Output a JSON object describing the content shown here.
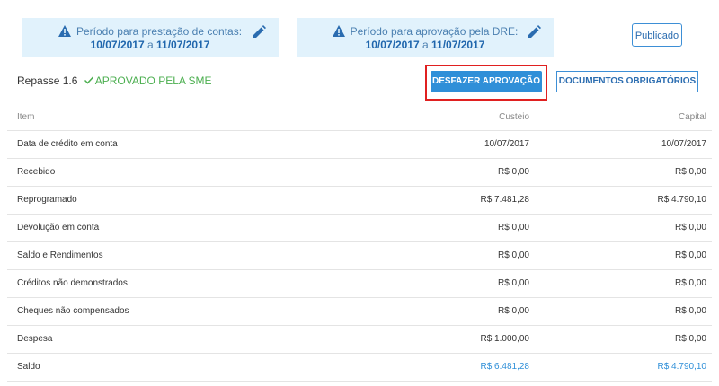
{
  "period_accounts": {
    "label": "Período para prestação de contas:",
    "start": "10/07/2017",
    "sep": "a",
    "end": "11/07/2017"
  },
  "period_dre": {
    "label": "Período para aprovação pela DRE:",
    "start": "10/07/2017",
    "sep": "a",
    "end": "11/07/2017"
  },
  "publish_button": "Publicado",
  "repasse": {
    "label": "Repasse 1.6",
    "status": "APROVADO PELA SME"
  },
  "buttons": {
    "undo": "DESFAZER APROVAÇÃO",
    "docs": "DOCUMENTOS OBRIGATÓRIOS"
  },
  "table": {
    "headers": [
      "Item",
      "Custeio",
      "Capital"
    ],
    "rows": [
      [
        "Data de crédito em conta",
        "10/07/2017",
        "10/07/2017"
      ],
      [
        "Recebido",
        "R$ 0,00",
        "R$ 0,00"
      ],
      [
        "Reprogramado",
        "R$ 7.481,28",
        "R$ 4.790,10"
      ],
      [
        "Devolução em conta",
        "R$ 0,00",
        "R$ 0,00"
      ],
      [
        "Saldo e Rendimentos",
        "R$ 0,00",
        "R$ 0,00"
      ],
      [
        "Créditos não demonstrados",
        "R$ 0,00",
        "R$ 0,00"
      ],
      [
        "Cheques não compensados",
        "R$ 0,00",
        "R$ 0,00"
      ],
      [
        "Despesa",
        "R$ 1.000,00",
        "R$ 0,00"
      ],
      [
        "Saldo",
        "R$ 6.481,28",
        "R$ 4.790,10"
      ]
    ]
  },
  "icons": {
    "warning": "warning-icon",
    "edit": "pencil-icon",
    "check": "check-icon"
  },
  "colors": {
    "accent": "#2f8fd8",
    "approved": "#4caf50",
    "banner": "#e1f2fc",
    "highlight": "#e02020"
  }
}
